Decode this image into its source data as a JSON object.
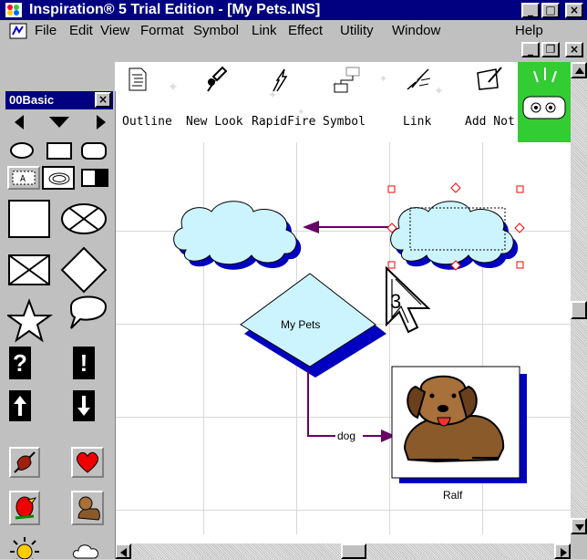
{
  "window": {
    "title": "Inspiration® 5 Trial Edition - [My Pets.INS]"
  },
  "menu": [
    "File",
    "Edit",
    "View",
    "Format",
    "Symbol",
    "Link",
    "Effect",
    "Utility",
    "Window",
    "Help"
  ],
  "palette": {
    "title": "00Basic",
    "close": "×",
    "question": "?",
    "exclaim": "!"
  },
  "toolbar": {
    "items": [
      "Outline",
      "New Look",
      "RapidFire",
      "Symbol",
      "Link",
      "Add Not"
    ]
  },
  "diagram": {
    "main_label": "My Pets",
    "link_label": "dog",
    "pet_label": "Ralf",
    "cursor_badge": "3"
  },
  "colors": {
    "titlebar": "#000080",
    "shape_fill": "#ccf4ff",
    "shadow": "#0000c0",
    "link": "#660066",
    "handle": "#ff0000"
  }
}
